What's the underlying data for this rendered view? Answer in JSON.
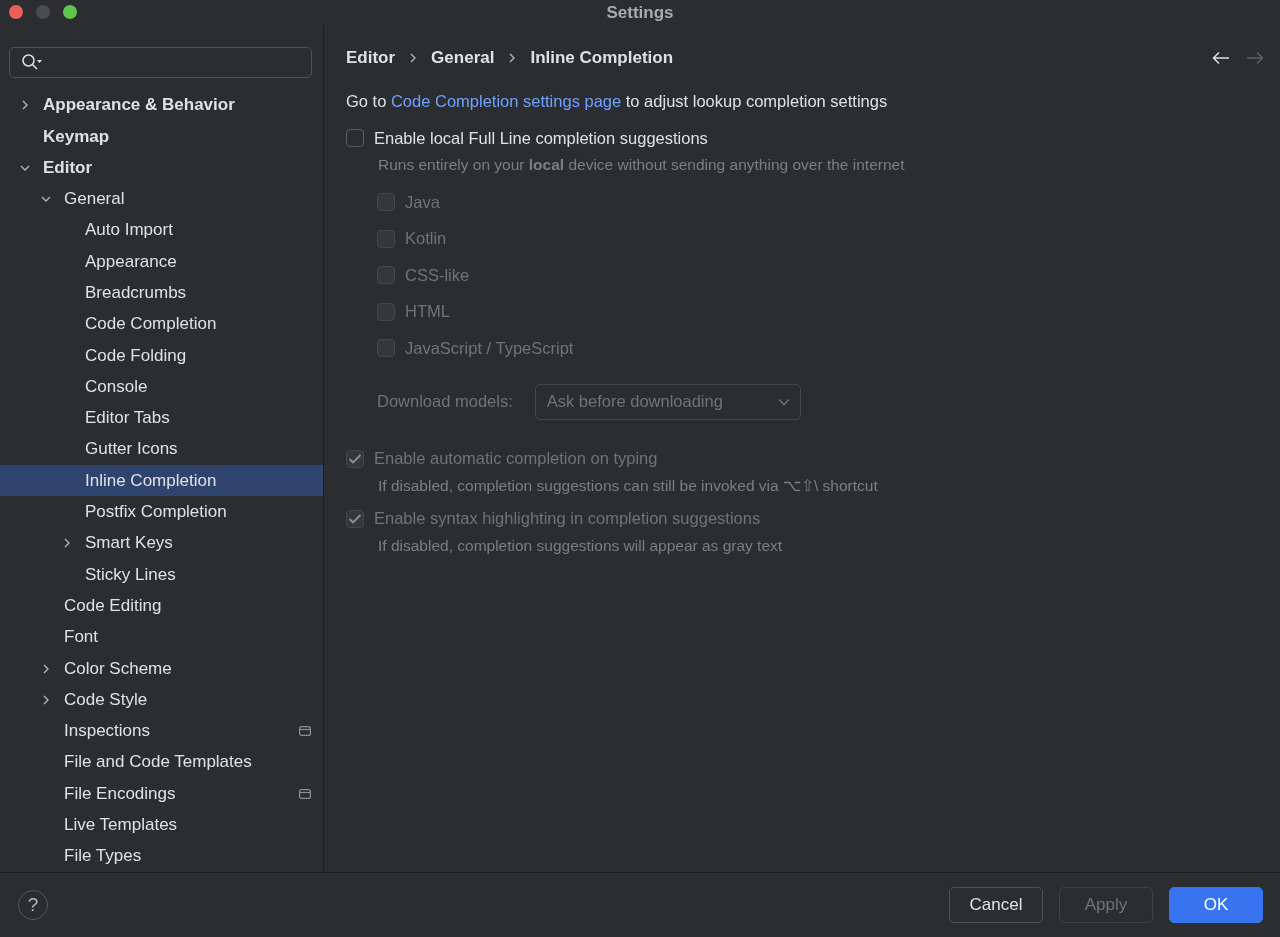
{
  "window": {
    "title": "Settings"
  },
  "help": {
    "label": "?"
  },
  "sidebar": {
    "items": [
      {
        "label": "Appearance & Behavior",
        "expanded": false,
        "selected": false
      },
      {
        "label": "Keymap",
        "selected": false
      },
      {
        "label": "Editor",
        "expanded": true,
        "selected": false,
        "children": [
          {
            "label": "General",
            "expanded": true,
            "selected": false,
            "children": [
              {
                "label": "Auto Import",
                "selected": false
              },
              {
                "label": "Appearance",
                "selected": false
              },
              {
                "label": "Breadcrumbs",
                "selected": false
              },
              {
                "label": "Code Completion",
                "selected": false
              },
              {
                "label": "Code Folding",
                "selected": false
              },
              {
                "label": "Console",
                "selected": false
              },
              {
                "label": "Editor Tabs",
                "selected": false
              },
              {
                "label": "Gutter Icons",
                "selected": false
              },
              {
                "label": "Inline Completion",
                "selected": true
              },
              {
                "label": "Postfix Completion",
                "selected": false
              },
              {
                "label": "Smart Keys",
                "expanded": false,
                "selected": false
              },
              {
                "label": "Sticky Lines",
                "selected": false
              }
            ]
          },
          {
            "label": "Code Editing",
            "selected": false
          },
          {
            "label": "Font",
            "selected": false
          },
          {
            "label": "Color Scheme",
            "expanded": false,
            "selected": false
          },
          {
            "label": "Code Style",
            "expanded": false,
            "selected": false
          },
          {
            "label": "Inspections",
            "selected": false,
            "scope_icon": true
          },
          {
            "label": "File and Code Templates",
            "selected": false
          },
          {
            "label": "File Encodings",
            "selected": false,
            "scope_icon": true
          },
          {
            "label": "Live Templates",
            "selected": false
          },
          {
            "label": "File Types",
            "selected": false
          }
        ]
      }
    ]
  },
  "breadcrumbs": [
    "Editor",
    "General",
    "Inline Completion"
  ],
  "nav": {
    "back_disabled": false,
    "forward_disabled": true
  },
  "intro": {
    "before": "Go to",
    "link": "Code Completion settings page",
    "after": "to adjust lookup completion settings"
  },
  "main_option": {
    "label": "Enable local Full Line completion suggestions",
    "checked": false,
    "disabled": false,
    "description": "Runs entirely on your **local** device without sending anything over the internet"
  },
  "languages": [
    {
      "label": "Java",
      "checked": false,
      "disabled": true
    },
    {
      "label": "Kotlin",
      "checked": false,
      "disabled": true
    },
    {
      "label": "CSS-like",
      "checked": false,
      "disabled": true
    },
    {
      "label": "HTML",
      "checked": false,
      "disabled": true
    },
    {
      "label": "JavaScript / TypeScript",
      "checked": false,
      "disabled": true
    }
  ],
  "download_models": {
    "label": "Download models:",
    "value": "Ask before downloading",
    "disabled": true
  },
  "options": [
    {
      "label": "Enable automatic completion on typing",
      "checked": true,
      "disabled": true,
      "description": "If disabled, completion suggestions can still be invoked via ⌥⇧\\ shortcut"
    },
    {
      "label": "Enable syntax highlighting in completion suggestions",
      "checked": true,
      "disabled": true,
      "description": "If disabled, completion suggestions will appear as gray text"
    }
  ],
  "buttons": [
    {
      "label": "Cancel",
      "kind": "secondary",
      "disabled": false
    },
    {
      "label": "Apply",
      "kind": "secondary",
      "disabled": true
    },
    {
      "label": "OK",
      "kind": "primary",
      "disabled": false
    }
  ]
}
